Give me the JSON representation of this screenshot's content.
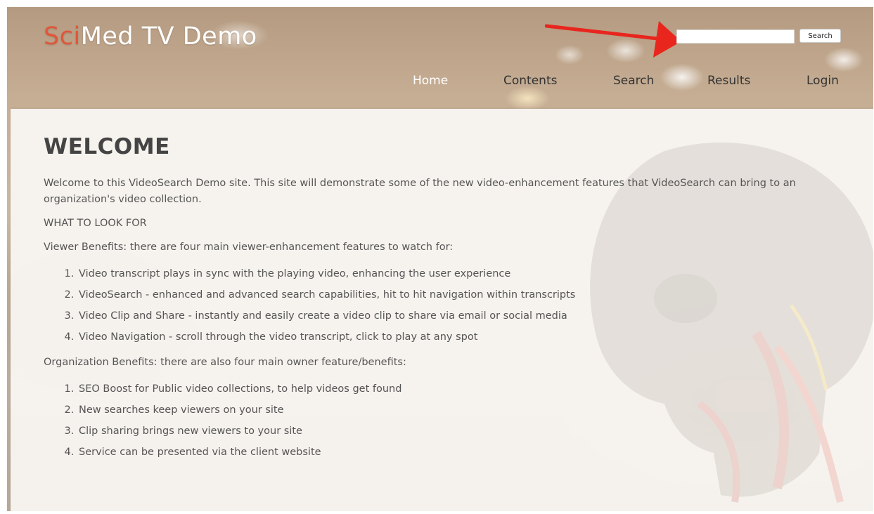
{
  "header": {
    "logo_accent": "Sci",
    "logo_rest": "Med TV Demo",
    "search_button": "Search",
    "search_value": ""
  },
  "nav": {
    "items": [
      "Home",
      "Contents",
      "Search",
      "Results",
      "Login"
    ],
    "active": "Home"
  },
  "main": {
    "title": "WELCOME",
    "intro": "Welcome to this VideoSearch Demo site. This site will demonstrate some of the new video-enhancement features that VideoSearch can bring to an organization's video collection.",
    "what_to_look_for": "WHAT TO LOOK FOR",
    "viewer_intro": "Viewer Benefits: there are four main viewer-enhancement features to watch for:",
    "viewer_items": [
      "Video transcript plays in sync with the playing video, enhancing the user experience",
      "VideoSearch - enhanced and advanced search capabilities, hit to hit navigation within transcripts",
      "Video Clip and Share - instantly and easily create a video clip to share via email or social media",
      "Video Navigation - scroll through the video transcript, click to play at any spot"
    ],
    "org_intro": "Organization Benefits: there are also four main owner feature/benefits:",
    "org_items": [
      "SEO Boost for Public video collections, to help videos get found",
      "New searches keep viewers on your site",
      "Clip sharing brings new viewers to your site",
      "Service can be presented via the client website"
    ]
  },
  "colors": {
    "logo_accent": "#e0573b",
    "annotation_arrow": "#e8261e",
    "nav_active": "#ffffff",
    "nav_inactive": "#333333"
  }
}
